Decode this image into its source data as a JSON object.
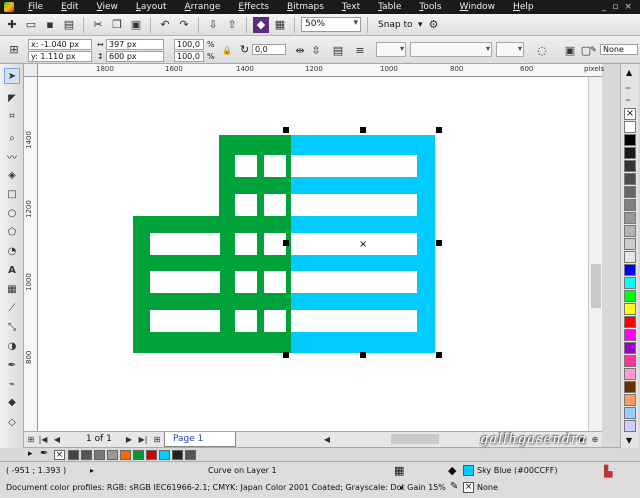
{
  "menu": [
    "File",
    "Edit",
    "View",
    "Layout",
    "Arrange",
    "Effects",
    "Bitmaps",
    "Text",
    "Table",
    "Tools",
    "Window",
    "Help"
  ],
  "window_controls": [
    "_",
    "▫",
    "×"
  ],
  "toolbar": {
    "zoom": "50%",
    "snap_to": "Snap to"
  },
  "propbar": {
    "x": "x: -1.040 px",
    "y": "y: 1.110 px",
    "w": "397 px",
    "h": "600 px",
    "scale_w": "100,0",
    "scale_h": "100,0",
    "pct": "%",
    "angle": "0,0",
    "outline": "None"
  },
  "ruler_top": [
    {
      "label": "1800",
      "pos": 58
    },
    {
      "label": "1600",
      "pos": 127
    },
    {
      "label": "1400",
      "pos": 198
    },
    {
      "label": "1200",
      "pos": 267
    },
    {
      "label": "1000",
      "pos": 342
    },
    {
      "label": "800",
      "pos": 412
    },
    {
      "label": "600",
      "pos": 482
    },
    {
      "label": "pixels",
      "pos": 546
    }
  ],
  "ruler_left": [
    {
      "label": "1400",
      "pos": 58
    },
    {
      "label": "1200",
      "pos": 127
    },
    {
      "label": "1000",
      "pos": 200
    },
    {
      "label": "800",
      "pos": 273
    }
  ],
  "palette_colors": [
    "#ffffff",
    "#000000",
    "#1a1a1a",
    "#333333",
    "#4d4d4d",
    "#666666",
    "#808080",
    "#999999",
    "#b3b3b3",
    "#cccccc",
    "#e6e6e6",
    "#0000ff",
    "#00ffff",
    "#00ff00",
    "#ffff00",
    "#ff0000",
    "#ff00ff",
    "#9900cc",
    "#ff3399",
    "#ff99cc",
    "#663300",
    "#ff9966",
    "#99ccff",
    "#ccccff"
  ],
  "pagebar": {
    "page_count": "1 of 1",
    "page_tab": "Page 1"
  },
  "doc_palette": [
    "#444444",
    "#555555",
    "#777777",
    "#999999",
    "#ff6600",
    "#009933",
    "#cc0000",
    "#00ccff",
    "#222222",
    "#555555"
  ],
  "status": {
    "coords": "( -951 ; 1.393 )",
    "object": "Curve on Layer 1",
    "profiles": "Document color profiles: RGB: sRGB IEC61966-2.1; CMYK: Japan Color 2001 Coated; Grayscale: Dot Gain 15%",
    "fill": "Sky Blue (#00CCFF)",
    "outline": "None",
    "watermark": "gallhgasendra"
  },
  "colors": {
    "green": "#00a339",
    "sky_blue": "#00ccff"
  }
}
